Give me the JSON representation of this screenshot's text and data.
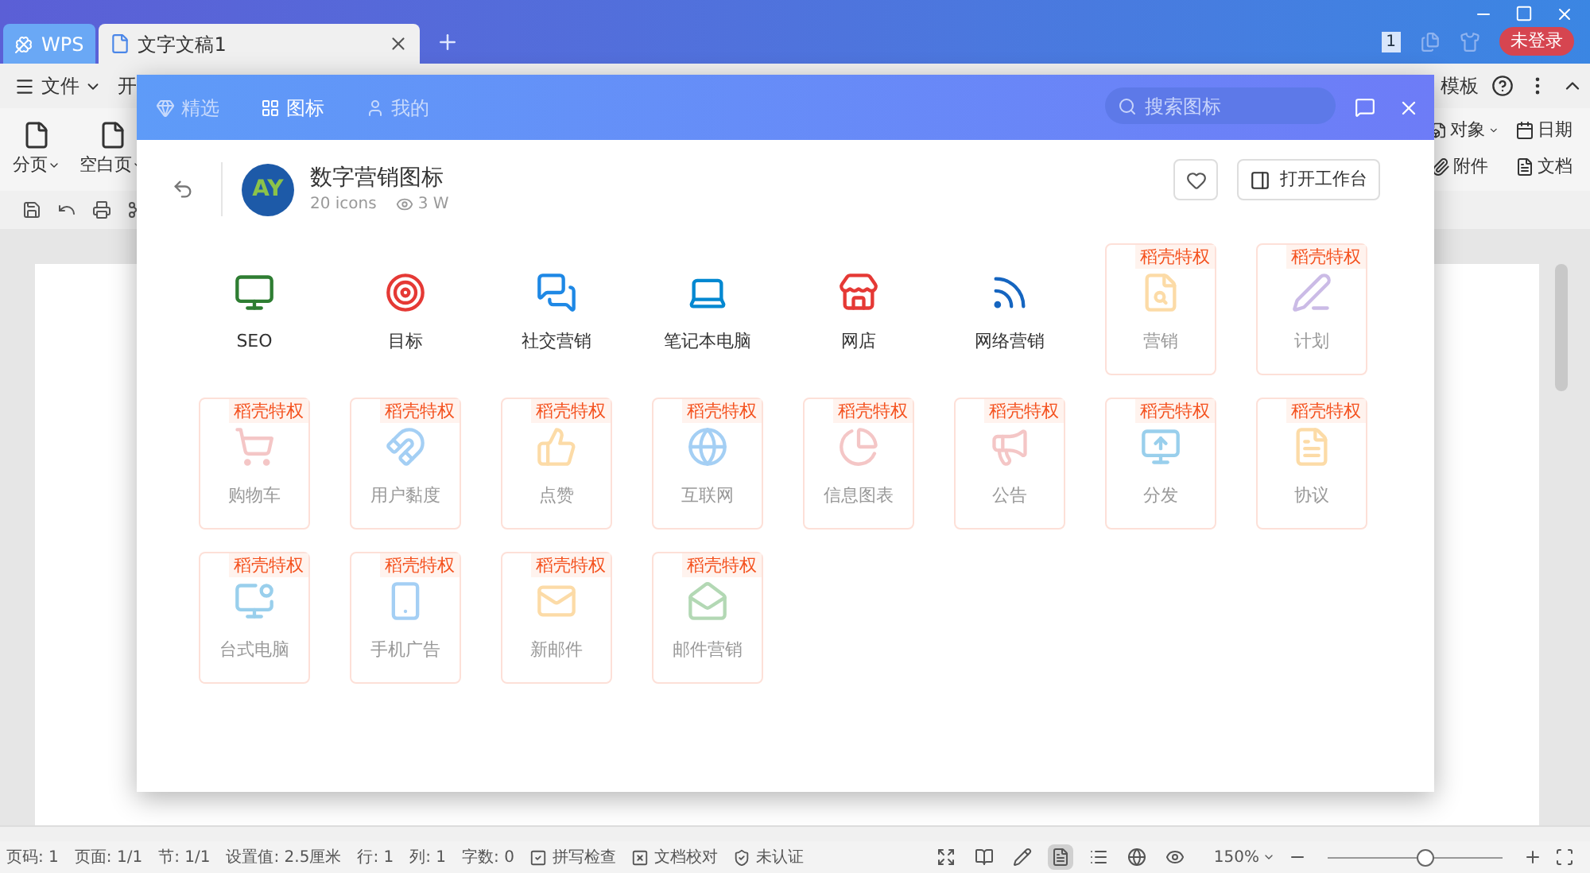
{
  "titlebar": {
    "tabs": [
      {
        "label": "WPS",
        "kind": "home",
        "selected": false
      },
      {
        "label": "文字文稿1",
        "kind": "doc",
        "selected": true
      }
    ],
    "badge": "1",
    "login": "未登录"
  },
  "menubar": {
    "file": "文件",
    "start": "开",
    "right_label": "模板"
  },
  "ribbon": {
    "left": [
      {
        "label": "分页"
      },
      {
        "label": "空白页"
      }
    ],
    "right": [
      {
        "label": "对象",
        "dropdown": true
      },
      {
        "label": "日期",
        "dropdown": false
      },
      {
        "label": "附件",
        "dropdown": false
      },
      {
        "label": "文档",
        "dropdown": false
      }
    ]
  },
  "dialog": {
    "tabs": [
      {
        "label": "精选",
        "selected": false
      },
      {
        "label": "图标",
        "selected": true
      },
      {
        "label": "我的",
        "selected": false
      }
    ],
    "search": {
      "placeholder": "搜索图标"
    },
    "collection": {
      "title": "数字营销图标",
      "count": "20 icons",
      "views": "3 W",
      "logo": "AY",
      "open_button": "打开工作台",
      "favorited": false
    },
    "icons": [
      {
        "label": "SEO",
        "premium": false
      },
      {
        "label": "目标",
        "premium": false
      },
      {
        "label": "社交营销",
        "premium": false
      },
      {
        "label": "笔记本电脑",
        "premium": false
      },
      {
        "label": "网店",
        "premium": false
      },
      {
        "label": "网络营销",
        "premium": false
      },
      {
        "label": "营销",
        "premium": true,
        "badge": "稻壳特权"
      },
      {
        "label": "计划",
        "premium": true,
        "badge": "稻壳特权"
      },
      {
        "label": "购物车",
        "premium": true,
        "badge": "稻壳特权"
      },
      {
        "label": "用户黏度",
        "premium": true,
        "badge": "稻壳特权"
      },
      {
        "label": "点赞",
        "premium": true,
        "badge": "稻壳特权"
      },
      {
        "label": "互联网",
        "premium": true,
        "badge": "稻壳特权"
      },
      {
        "label": "信息图表",
        "premium": true,
        "badge": "稻壳特权"
      },
      {
        "label": "公告",
        "premium": true,
        "badge": "稻壳特权"
      },
      {
        "label": "分发",
        "premium": true,
        "badge": "稻壳特权"
      },
      {
        "label": "协议",
        "premium": true,
        "badge": "稻壳特权"
      },
      {
        "label": "台式电脑",
        "premium": true,
        "badge": "稻壳特权"
      },
      {
        "label": "手机广告",
        "premium": true,
        "badge": "稻壳特权"
      },
      {
        "label": "新邮件",
        "premium": true,
        "badge": "稻壳特权"
      },
      {
        "label": "邮件营销",
        "premium": true,
        "badge": "稻壳特权"
      }
    ]
  },
  "status_bar": {
    "items": [
      {
        "label": "页码: 1",
        "kind": "text"
      },
      {
        "label": "页面: 1/1",
        "kind": "text"
      },
      {
        "label": "节: 1/1",
        "kind": "text"
      },
      {
        "label": "设置值: 2.5厘米",
        "kind": "text"
      },
      {
        "label": "行: 1",
        "kind": "text"
      },
      {
        "label": "列: 1",
        "kind": "text"
      },
      {
        "label": "字数: 0",
        "kind": "text"
      },
      {
        "label": "拼写检查",
        "kind": "spell"
      },
      {
        "label": "文档校对",
        "kind": "proof"
      },
      {
        "label": "未认证",
        "kind": "cert"
      }
    ],
    "view_modes": [
      {
        "selected": false
      },
      {
        "selected": false
      },
      {
        "selected": false
      },
      {
        "selected": true
      },
      {
        "selected": false
      },
      {
        "selected": false
      },
      {
        "selected": false
      }
    ],
    "zoom": "150%",
    "zoom_slider": {
      "level": 0.55
    }
  }
}
